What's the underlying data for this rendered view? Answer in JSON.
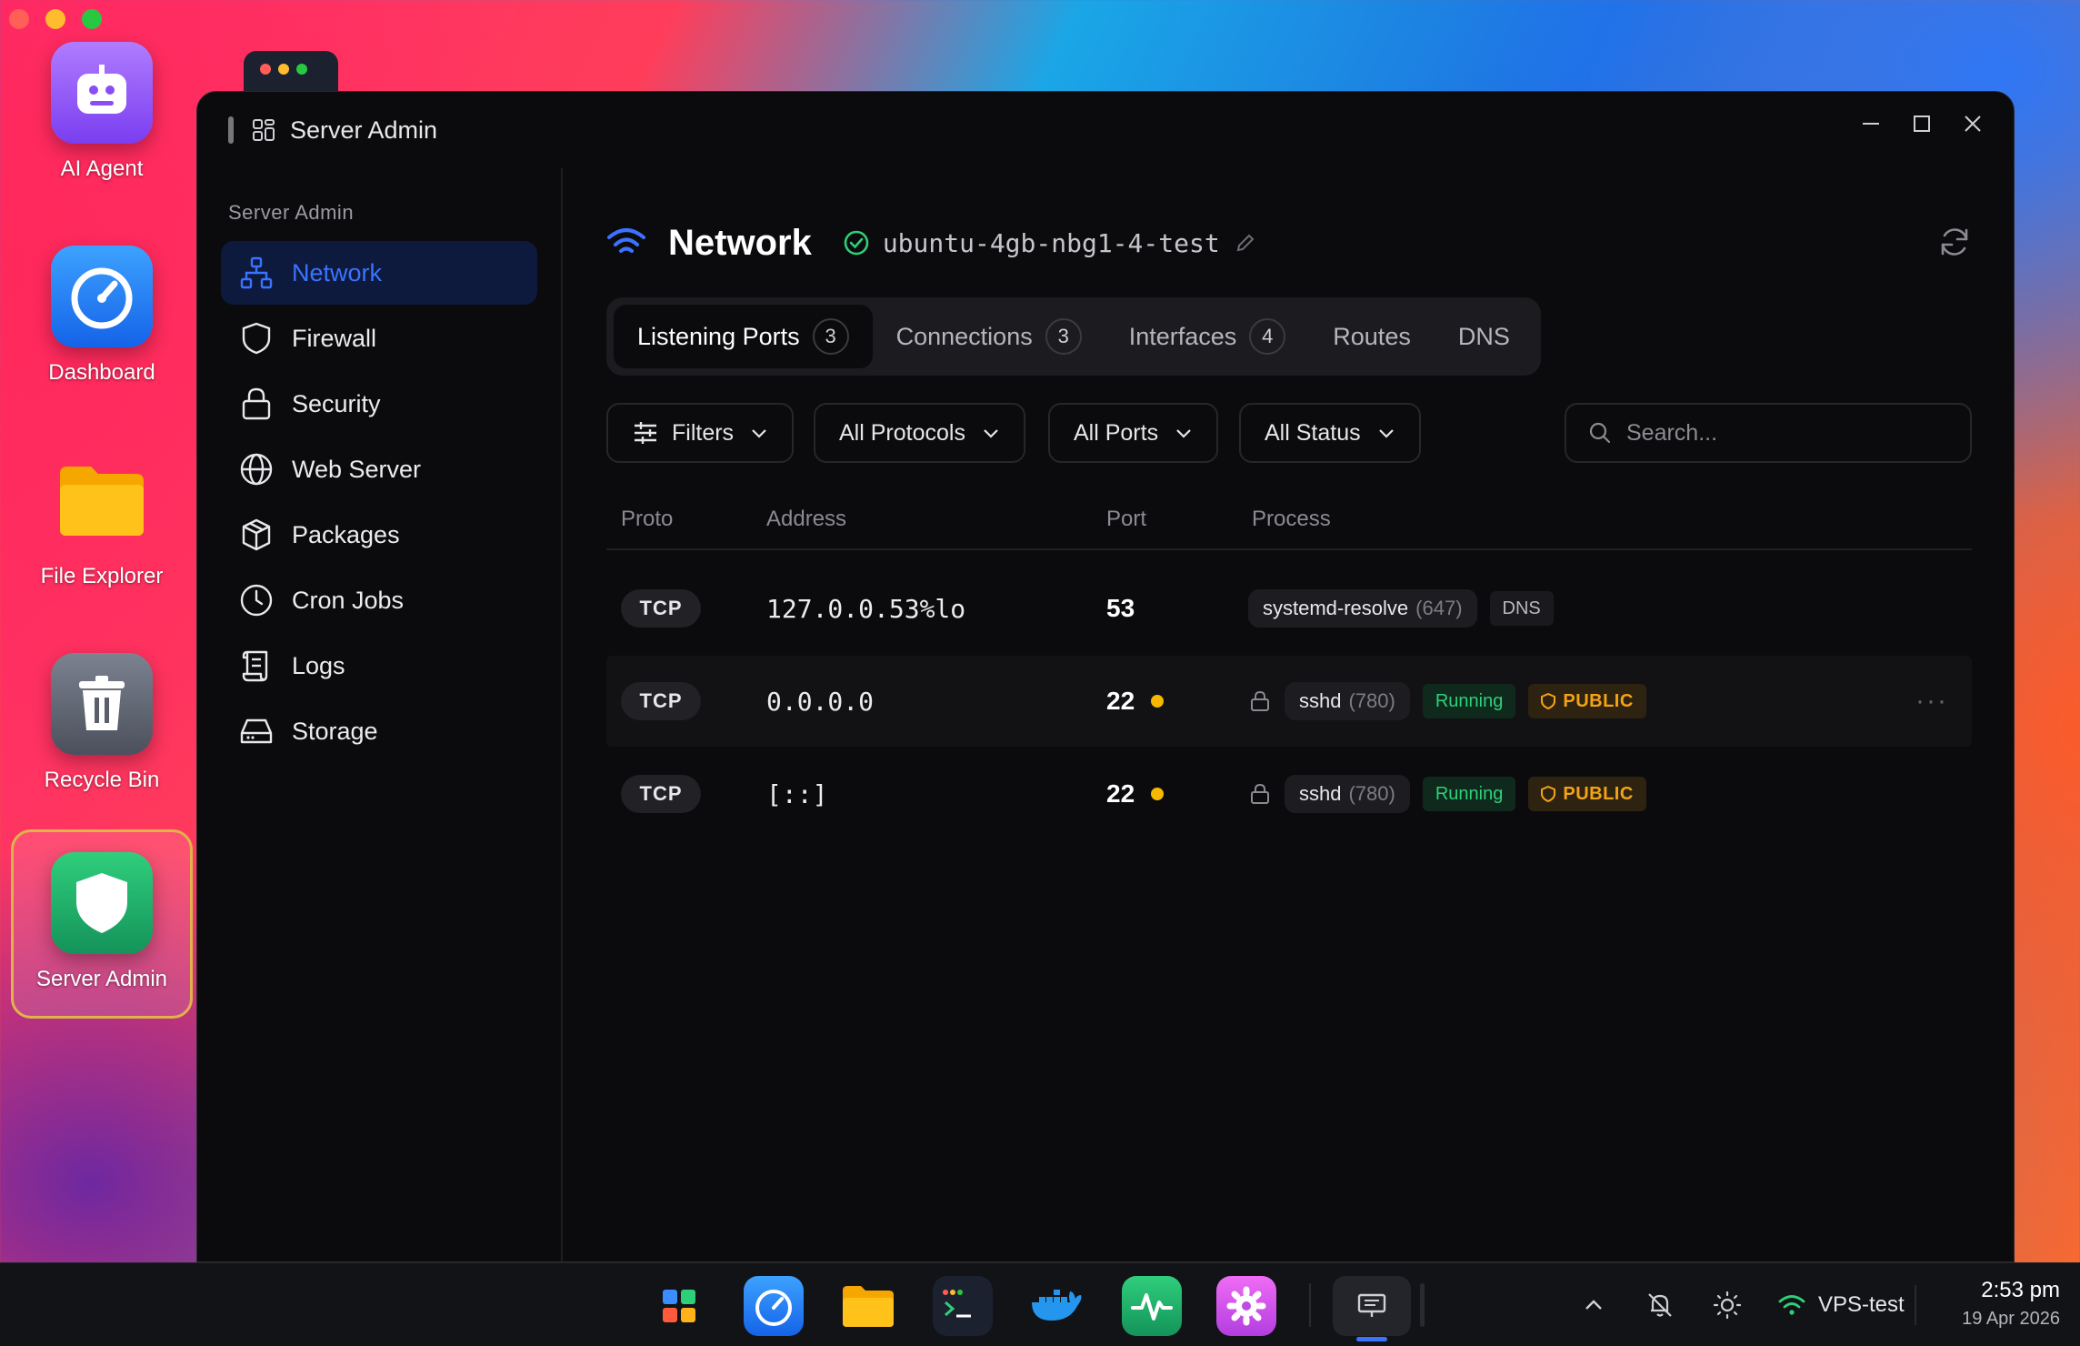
{
  "desktop": {
    "icons": [
      {
        "label": "AI Agent"
      },
      {
        "label": "Dashboard"
      },
      {
        "label": "File Explorer"
      },
      {
        "label": "Recycle Bin"
      },
      {
        "label": "Server Admin"
      }
    ]
  },
  "window": {
    "title": "Server Admin"
  },
  "sidebar": {
    "heading": "Server Admin",
    "items": [
      {
        "label": "Network",
        "icon": "network-icon",
        "active": true
      },
      {
        "label": "Firewall",
        "icon": "shield-icon"
      },
      {
        "label": "Security",
        "icon": "lock-icon"
      },
      {
        "label": "Web Server",
        "icon": "globe-icon"
      },
      {
        "label": "Packages",
        "icon": "package-icon"
      },
      {
        "label": "Cron Jobs",
        "icon": "clock-icon"
      },
      {
        "label": "Logs",
        "icon": "scroll-icon"
      },
      {
        "label": "Storage",
        "icon": "hard-drive-icon"
      }
    ]
  },
  "header": {
    "title": "Network",
    "hostname": "ubuntu-4gb-nbg1-4-test"
  },
  "tabs": [
    {
      "label": "Listening Ports",
      "count": "3",
      "active": true
    },
    {
      "label": "Connections",
      "count": "3"
    },
    {
      "label": "Interfaces",
      "count": "4"
    },
    {
      "label": "Routes"
    },
    {
      "label": "DNS"
    }
  ],
  "filters": {
    "filters_label": "Filters",
    "protocols_label": "All Protocols",
    "ports_label": "All Ports",
    "status_label": "All Status",
    "search_placeholder": "Search..."
  },
  "table": {
    "columns": [
      "Proto",
      "Address",
      "Port",
      "Process"
    ],
    "rows": [
      {
        "proto": "TCP",
        "address": "127.0.0.53%lo",
        "port": "53",
        "process": "systemd-resolve",
        "pid": "(647)",
        "tag": "DNS"
      },
      {
        "proto": "TCP",
        "address": "0.0.0.0",
        "port": "22",
        "process": "sshd",
        "pid": "(780)",
        "status": "Running",
        "exposure": "PUBLIC"
      },
      {
        "proto": "TCP",
        "address": "[::]",
        "port": "22",
        "process": "sshd",
        "pid": "(780)",
        "status": "Running",
        "exposure": "PUBLIC"
      }
    ]
  },
  "taskbar": {
    "network_name": "VPS-test",
    "time": "2:53 pm",
    "date": "19 Apr 2026"
  },
  "colors": {
    "accent": "#3b73ff",
    "running": "#2fcf7a",
    "public": "#f3a316",
    "port_dot": "#f5b800"
  }
}
